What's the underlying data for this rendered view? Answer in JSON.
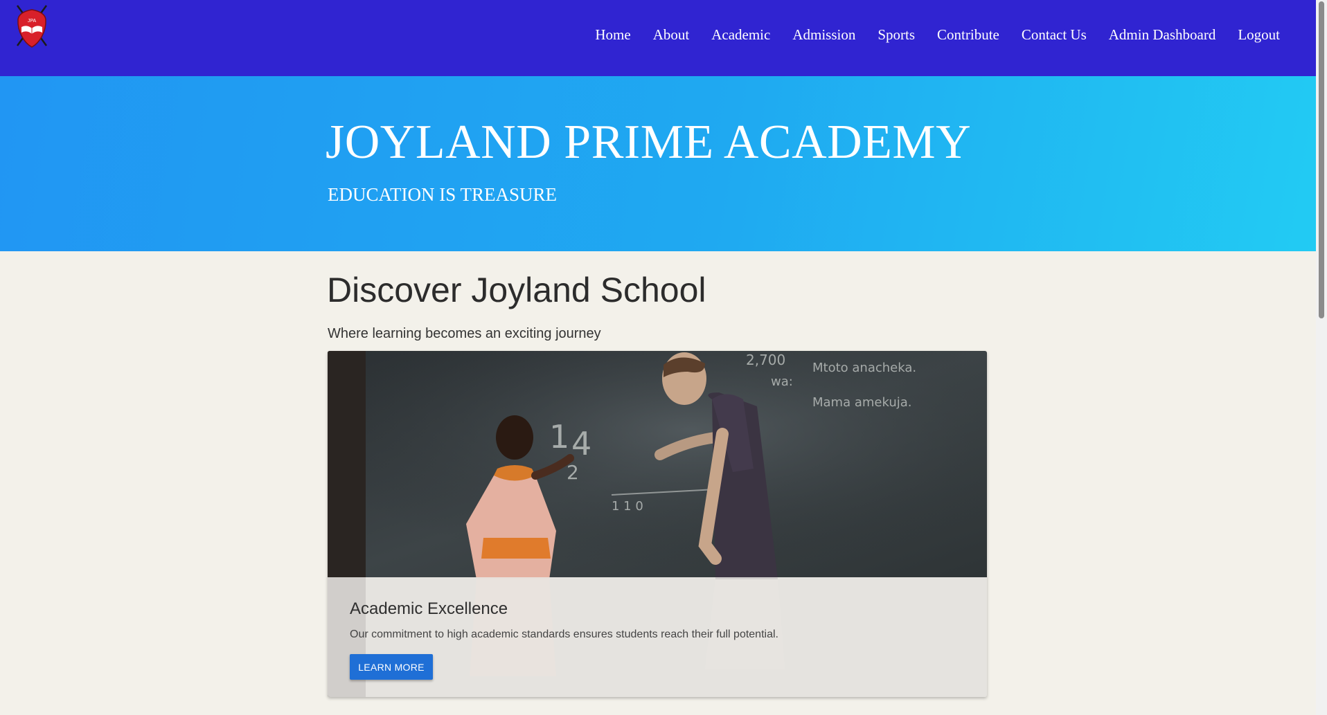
{
  "brand": {
    "logo_text": "JPA"
  },
  "nav": {
    "items": [
      {
        "label": "Home"
      },
      {
        "label": "About"
      },
      {
        "label": "Academic"
      },
      {
        "label": "Admission"
      },
      {
        "label": "Sports"
      },
      {
        "label": "Contribute"
      },
      {
        "label": "Contact Us"
      },
      {
        "label": "Admin Dashboard"
      },
      {
        "label": "Logout"
      }
    ]
  },
  "hero": {
    "title": "JOYLAND PRIME ACADEMY",
    "subtitle": "EDUCATION IS TREASURE"
  },
  "main": {
    "title": "Discover Joyland School",
    "subtitle": "Where learning becomes an exciting journey",
    "card": {
      "title": "Academic Excellence",
      "text": "Our commitment to high academic standards ensures students reach their full potential.",
      "button_label": "LEARN MORE",
      "chalk_words": [
        "2,700",
        "Mtoto anacheka.",
        "wa:",
        "Mama amekuja.",
        "1",
        "4",
        "2",
        "1 1 0"
      ]
    }
  },
  "colors": {
    "navbar": "#3024d1",
    "hero_start": "#2196f3",
    "hero_end": "#22cbf3",
    "page_background": "#f3f1ea",
    "button": "#1f6fd6",
    "logo_red": "#d8202a"
  }
}
